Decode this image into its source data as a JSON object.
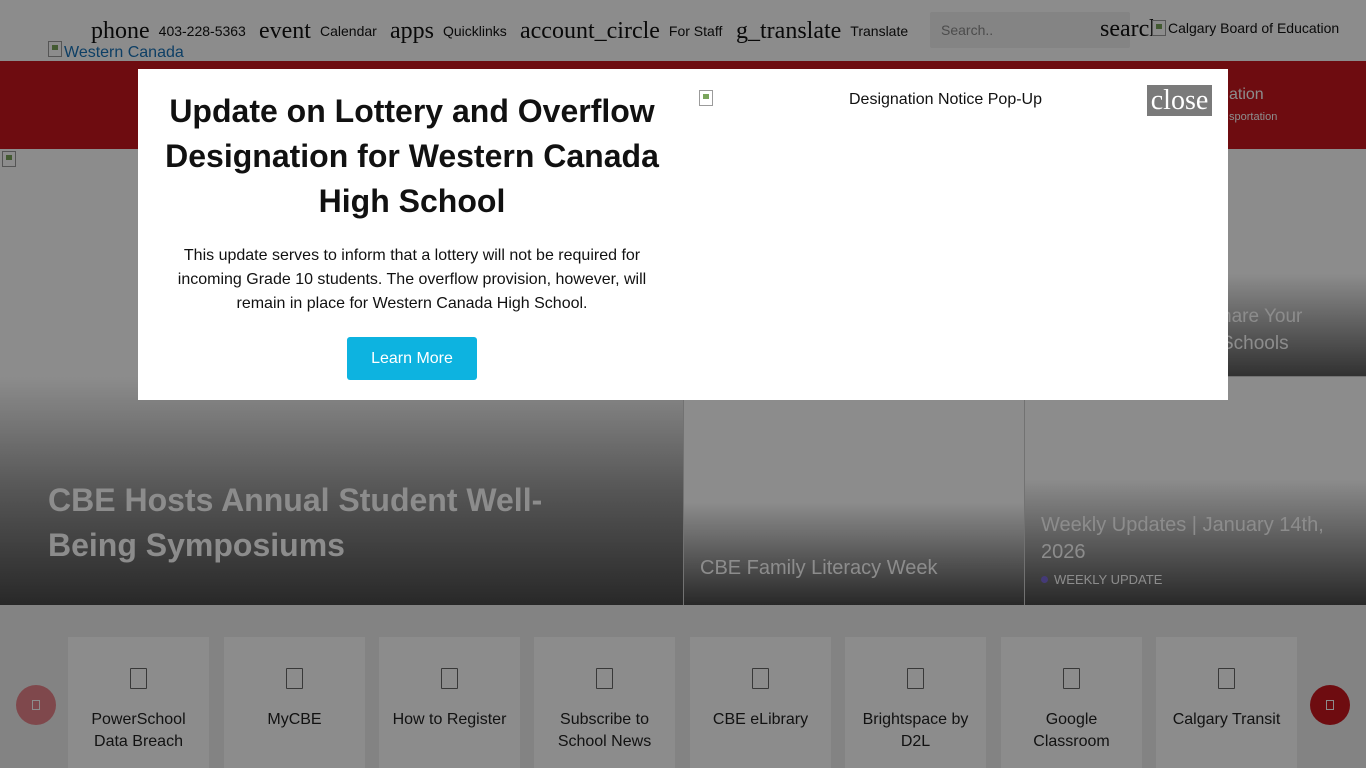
{
  "topbar": {
    "phone_icon": "phone",
    "phone_label": "403-228-5363",
    "calendar_icon": "event",
    "calendar_label": "Calendar",
    "quicklinks_icon": "apps",
    "quicklinks_label": "Quicklinks",
    "staff_icon": "account_circle",
    "staff_label": "For Staff",
    "translate_icon": "g_translate",
    "translate_label": "Translate",
    "search_placeholder": "Search..",
    "search_button": "search",
    "cbe_logo_alt": "Calgary Board of Education",
    "site_logo_alt": "Western Canada High School"
  },
  "nav": {
    "fragment_1": "ation",
    "fragment_2": "sportation"
  },
  "hero": {
    "main_title": "CBE Hosts Annual Student Well-Being Symposiums",
    "card_top_right_title": "hare Your Schools",
    "card_bottom_middle_title": "CBE Family Literacy Week",
    "card_bottom_right_title": "Weekly Updates | January 14th, 2026",
    "card_bottom_right_tag": "WEEKLY UPDATE",
    "tag_color": "#7c6ad9"
  },
  "quicklinks": {
    "items": [
      {
        "label": "PowerSchool Data Breach"
      },
      {
        "label": "MyCBE"
      },
      {
        "label": "How to Register"
      },
      {
        "label": "Subscribe to School News"
      },
      {
        "label": "CBE eLibrary"
      },
      {
        "label": "Brightspace by D2L"
      },
      {
        "label": "Google Classroom"
      },
      {
        "label": "Calgary Transit"
      }
    ]
  },
  "modal": {
    "title": "Update on Lottery and Overflow Designation for Western Canada High School",
    "body": "This update serves to inform that a lottery will not be required for incoming Grade 10 students. The overflow provision, however, will remain in place for Western Canada High School.",
    "button_label": "Learn More",
    "image_alt": "Designation Notice Pop-Up",
    "close_label": "close"
  },
  "colors": {
    "brand_red": "#c8171e",
    "accent_cyan": "#0db3e0",
    "overlay": "rgba(0,0,0,0.45)"
  }
}
